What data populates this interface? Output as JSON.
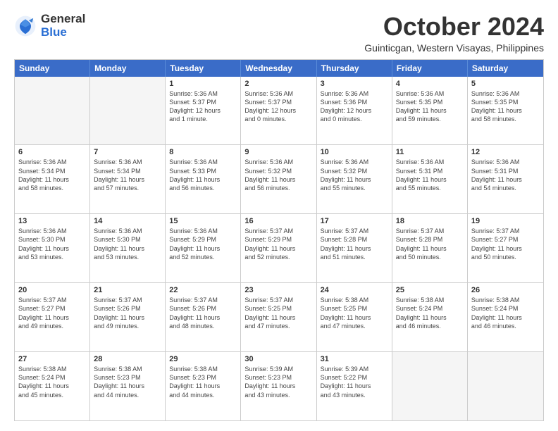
{
  "logo": {
    "general": "General",
    "blue": "Blue"
  },
  "header": {
    "month": "October 2024",
    "location": "Guinticgan, Western Visayas, Philippines"
  },
  "days": [
    "Sunday",
    "Monday",
    "Tuesday",
    "Wednesday",
    "Thursday",
    "Friday",
    "Saturday"
  ],
  "rows": [
    [
      {
        "num": "",
        "text": ""
      },
      {
        "num": "",
        "text": ""
      },
      {
        "num": "1",
        "text": "Sunrise: 5:36 AM\nSunset: 5:37 PM\nDaylight: 12 hours\nand 1 minute."
      },
      {
        "num": "2",
        "text": "Sunrise: 5:36 AM\nSunset: 5:37 PM\nDaylight: 12 hours\nand 0 minutes."
      },
      {
        "num": "3",
        "text": "Sunrise: 5:36 AM\nSunset: 5:36 PM\nDaylight: 12 hours\nand 0 minutes."
      },
      {
        "num": "4",
        "text": "Sunrise: 5:36 AM\nSunset: 5:35 PM\nDaylight: 11 hours\nand 59 minutes."
      },
      {
        "num": "5",
        "text": "Sunrise: 5:36 AM\nSunset: 5:35 PM\nDaylight: 11 hours\nand 58 minutes."
      }
    ],
    [
      {
        "num": "6",
        "text": "Sunrise: 5:36 AM\nSunset: 5:34 PM\nDaylight: 11 hours\nand 58 minutes."
      },
      {
        "num": "7",
        "text": "Sunrise: 5:36 AM\nSunset: 5:34 PM\nDaylight: 11 hours\nand 57 minutes."
      },
      {
        "num": "8",
        "text": "Sunrise: 5:36 AM\nSunset: 5:33 PM\nDaylight: 11 hours\nand 56 minutes."
      },
      {
        "num": "9",
        "text": "Sunrise: 5:36 AM\nSunset: 5:32 PM\nDaylight: 11 hours\nand 56 minutes."
      },
      {
        "num": "10",
        "text": "Sunrise: 5:36 AM\nSunset: 5:32 PM\nDaylight: 11 hours\nand 55 minutes."
      },
      {
        "num": "11",
        "text": "Sunrise: 5:36 AM\nSunset: 5:31 PM\nDaylight: 11 hours\nand 55 minutes."
      },
      {
        "num": "12",
        "text": "Sunrise: 5:36 AM\nSunset: 5:31 PM\nDaylight: 11 hours\nand 54 minutes."
      }
    ],
    [
      {
        "num": "13",
        "text": "Sunrise: 5:36 AM\nSunset: 5:30 PM\nDaylight: 11 hours\nand 53 minutes."
      },
      {
        "num": "14",
        "text": "Sunrise: 5:36 AM\nSunset: 5:30 PM\nDaylight: 11 hours\nand 53 minutes."
      },
      {
        "num": "15",
        "text": "Sunrise: 5:36 AM\nSunset: 5:29 PM\nDaylight: 11 hours\nand 52 minutes."
      },
      {
        "num": "16",
        "text": "Sunrise: 5:37 AM\nSunset: 5:29 PM\nDaylight: 11 hours\nand 52 minutes."
      },
      {
        "num": "17",
        "text": "Sunrise: 5:37 AM\nSunset: 5:28 PM\nDaylight: 11 hours\nand 51 minutes."
      },
      {
        "num": "18",
        "text": "Sunrise: 5:37 AM\nSunset: 5:28 PM\nDaylight: 11 hours\nand 50 minutes."
      },
      {
        "num": "19",
        "text": "Sunrise: 5:37 AM\nSunset: 5:27 PM\nDaylight: 11 hours\nand 50 minutes."
      }
    ],
    [
      {
        "num": "20",
        "text": "Sunrise: 5:37 AM\nSunset: 5:27 PM\nDaylight: 11 hours\nand 49 minutes."
      },
      {
        "num": "21",
        "text": "Sunrise: 5:37 AM\nSunset: 5:26 PM\nDaylight: 11 hours\nand 49 minutes."
      },
      {
        "num": "22",
        "text": "Sunrise: 5:37 AM\nSunset: 5:26 PM\nDaylight: 11 hours\nand 48 minutes."
      },
      {
        "num": "23",
        "text": "Sunrise: 5:37 AM\nSunset: 5:25 PM\nDaylight: 11 hours\nand 47 minutes."
      },
      {
        "num": "24",
        "text": "Sunrise: 5:38 AM\nSunset: 5:25 PM\nDaylight: 11 hours\nand 47 minutes."
      },
      {
        "num": "25",
        "text": "Sunrise: 5:38 AM\nSunset: 5:24 PM\nDaylight: 11 hours\nand 46 minutes."
      },
      {
        "num": "26",
        "text": "Sunrise: 5:38 AM\nSunset: 5:24 PM\nDaylight: 11 hours\nand 46 minutes."
      }
    ],
    [
      {
        "num": "27",
        "text": "Sunrise: 5:38 AM\nSunset: 5:24 PM\nDaylight: 11 hours\nand 45 minutes."
      },
      {
        "num": "28",
        "text": "Sunrise: 5:38 AM\nSunset: 5:23 PM\nDaylight: 11 hours\nand 44 minutes."
      },
      {
        "num": "29",
        "text": "Sunrise: 5:38 AM\nSunset: 5:23 PM\nDaylight: 11 hours\nand 44 minutes."
      },
      {
        "num": "30",
        "text": "Sunrise: 5:39 AM\nSunset: 5:23 PM\nDaylight: 11 hours\nand 43 minutes."
      },
      {
        "num": "31",
        "text": "Sunrise: 5:39 AM\nSunset: 5:22 PM\nDaylight: 11 hours\nand 43 minutes."
      },
      {
        "num": "",
        "text": ""
      },
      {
        "num": "",
        "text": ""
      }
    ]
  ]
}
